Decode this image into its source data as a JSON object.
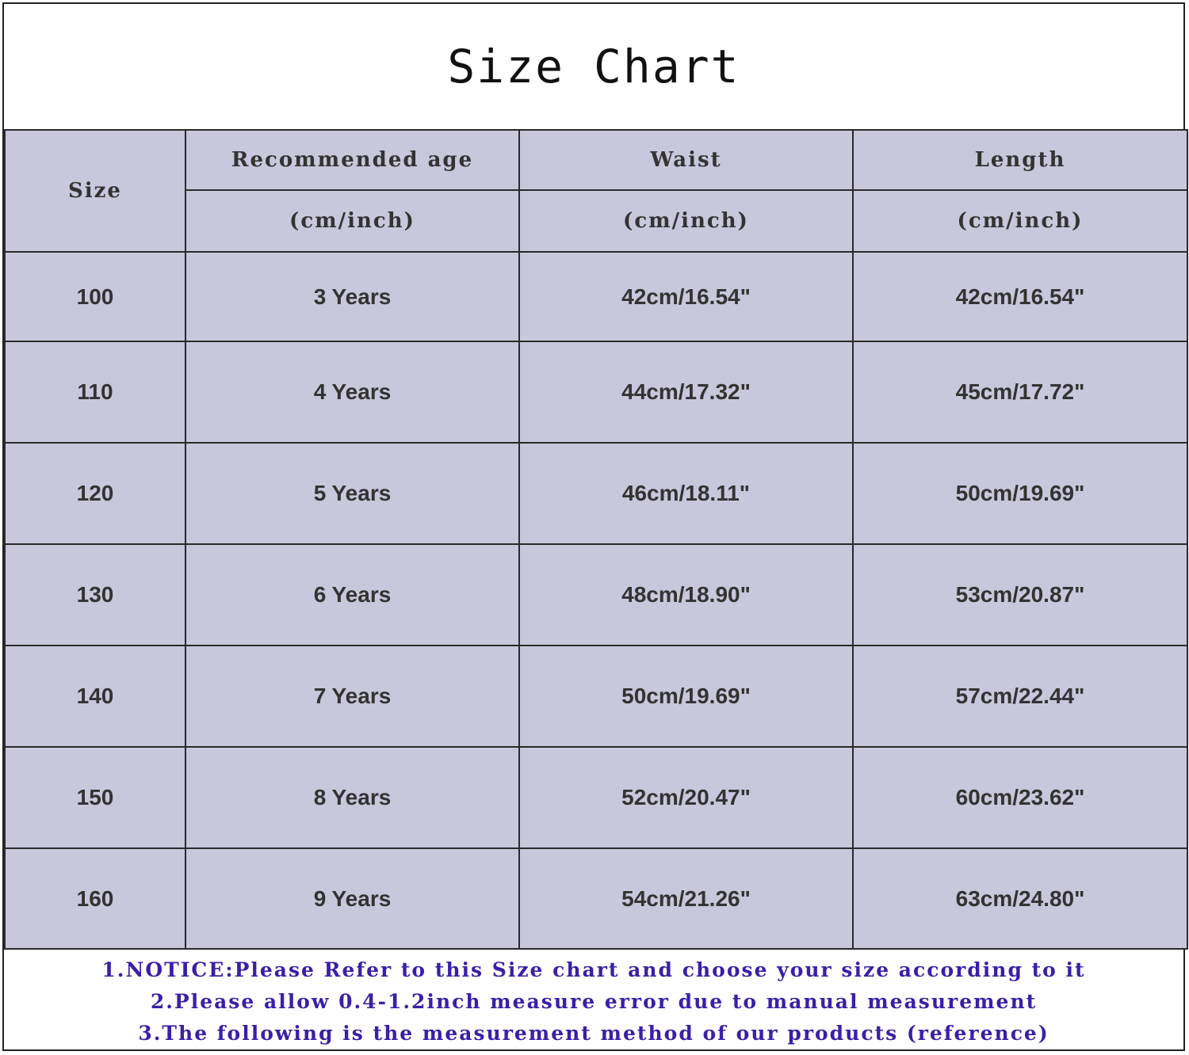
{
  "title": "Size Chart",
  "header": {
    "size": "Size",
    "age": "Recommended age",
    "waist": "Waist",
    "length": "Length",
    "unit": "(cm/inch)"
  },
  "rows": [
    {
      "size": "100",
      "age": "3 Years",
      "waist": "42cm/16.54\"",
      "length": "42cm/16.54\""
    },
    {
      "size": "110",
      "age": "4 Years",
      "waist": "44cm/17.32\"",
      "length": "45cm/17.72\""
    },
    {
      "size": "120",
      "age": "5 Years",
      "waist": "46cm/18.11\"",
      "length": "50cm/19.69\""
    },
    {
      "size": "130",
      "age": "6 Years",
      "waist": "48cm/18.90\"",
      "length": "53cm/20.87\""
    },
    {
      "size": "140",
      "age": "7 Years",
      "waist": "50cm/19.69\"",
      "length": "57cm/22.44\""
    },
    {
      "size": "150",
      "age": "8 Years",
      "waist": "52cm/20.47\"",
      "length": "60cm/23.62\""
    },
    {
      "size": "160",
      "age": "9 Years",
      "waist": "54cm/21.26\"",
      "length": "63cm/24.80\""
    }
  ],
  "notes": [
    "1.NOTICE:Please Refer to this Size chart and choose your size according to it",
    "2.Please allow 0.4-1.2inch measure error due to manual measurement",
    "3.The following is the measurement method of our products (reference)"
  ],
  "colors": {
    "table_bg": "#c8c7dc",
    "note_text": "#3a1fa8"
  }
}
